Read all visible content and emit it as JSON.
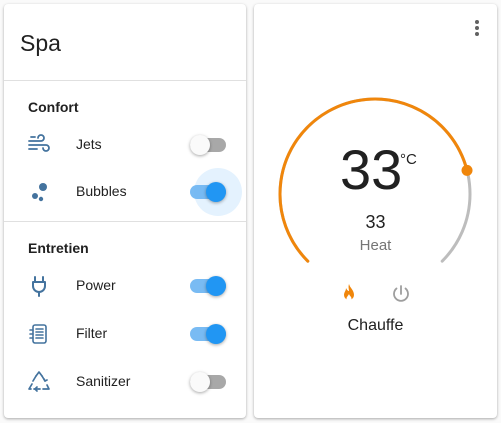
{
  "left_card": {
    "title": "Spa",
    "sections": [
      {
        "title": "Confort",
        "items": [
          {
            "label": "Jets",
            "icon": "wind-icon",
            "state": "off"
          },
          {
            "label": "Bubbles",
            "icon": "bubbles-icon",
            "state": "on"
          }
        ]
      },
      {
        "title": "Entretien",
        "items": [
          {
            "label": "Power",
            "icon": "plug-icon",
            "state": "on"
          },
          {
            "label": "Filter",
            "icon": "filter-icon",
            "state": "on"
          },
          {
            "label": "Sanitizer",
            "icon": "recycle-icon",
            "state": "off"
          }
        ]
      }
    ]
  },
  "thermostat": {
    "target_temp": "33",
    "unit": "°C",
    "current_temp": "33",
    "mode_label": "Heat",
    "action_label": "Chauffe",
    "setpoint_fraction": 0.78,
    "modes": [
      {
        "icon": "fire-icon",
        "active": true
      },
      {
        "icon": "power-icon",
        "active": false
      }
    ]
  },
  "colors": {
    "accent": "#2196f3",
    "heat": "#f0860b",
    "icon": "#44739e",
    "inactive": "#bdbdbd"
  }
}
